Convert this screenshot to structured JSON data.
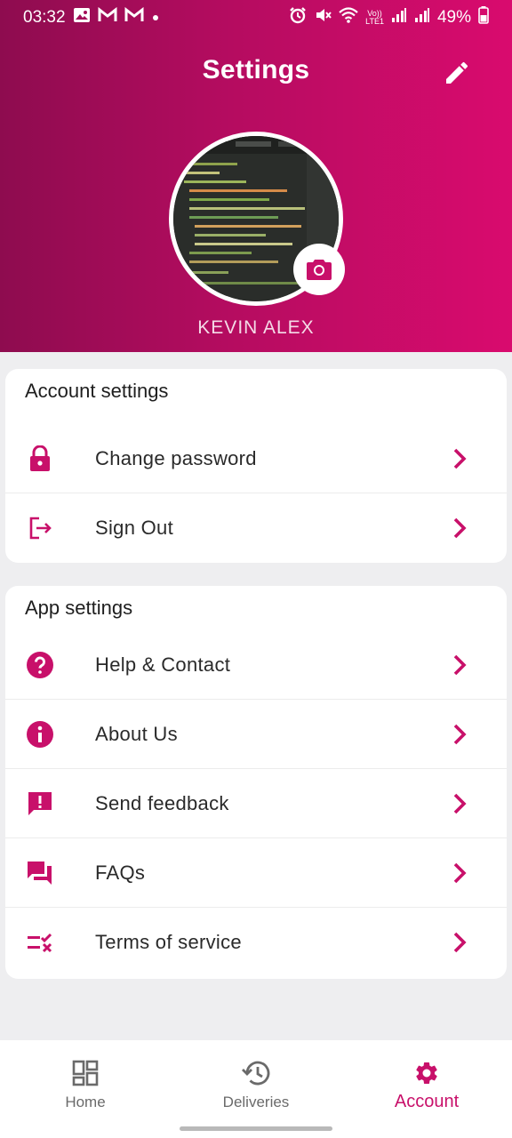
{
  "status_bar": {
    "time": "03:32",
    "left_icons": [
      "image-icon",
      "gmail-icon",
      "gmail-icon",
      "dot-icon"
    ],
    "right_icons": [
      "alarm-icon",
      "mute-icon",
      "wifi-icon",
      "volte-icon",
      "signal-icon",
      "signal-icon"
    ],
    "volte_label": "Vo))\nLTE1",
    "battery": "49%"
  },
  "header": {
    "title": "Settings",
    "user_name": "KEVIN ALEX"
  },
  "account_settings": {
    "title": "Account settings",
    "items": [
      {
        "label": "Change password",
        "icon": "lock-icon"
      },
      {
        "label": "Sign Out",
        "icon": "sign-out-icon"
      }
    ]
  },
  "app_settings": {
    "title": "App settings",
    "items": [
      {
        "label": "Help & Contact",
        "icon": "help-icon"
      },
      {
        "label": "About Us",
        "icon": "info-icon"
      },
      {
        "label": "Send feedback",
        "icon": "feedback-icon"
      },
      {
        "label": "FAQs",
        "icon": "forum-icon"
      },
      {
        "label": "Terms of service",
        "icon": "rule-icon"
      }
    ]
  },
  "bottom_nav": {
    "items": [
      {
        "label": "Home",
        "icon": "dashboard-icon",
        "active": false
      },
      {
        "label": "Deliveries",
        "icon": "history-icon",
        "active": false
      },
      {
        "label": "Account",
        "icon": "gear-icon",
        "active": true
      }
    ]
  },
  "colors": {
    "accent": "#c8106a",
    "header_gradient_start": "#8e0c4f",
    "header_gradient_end": "#d90b6e",
    "inactive_nav": "#6a6a6a"
  }
}
